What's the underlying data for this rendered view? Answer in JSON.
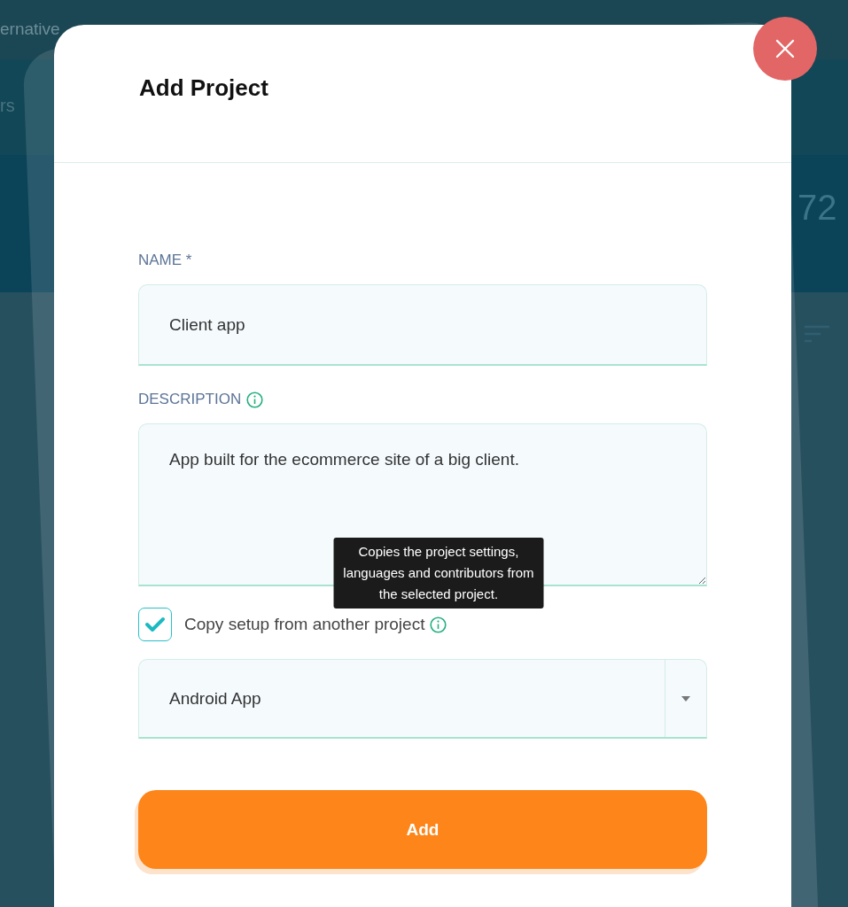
{
  "background": {
    "texts": [
      {
        "kind": "nav",
        "text": "ernative"
      },
      {
        "kind": "tab",
        "text": "rs"
      },
      {
        "kind": "stat",
        "text": "72"
      }
    ]
  },
  "dialog": {
    "title": "Add Project",
    "fields": [
      {
        "kind": "input",
        "label": "NAME *",
        "info": false,
        "value": "Client app"
      },
      {
        "kind": "textarea",
        "label": "DESCRIPTION",
        "info": true,
        "value": "App built for the ecommerce site of a big client."
      }
    ],
    "copy_setup": {
      "label": "Copy setup from another project",
      "checked": true,
      "info": true,
      "tooltip": "Copies the project settings, languages and contributors from the selected project."
    },
    "project_select": {
      "value": "Android App"
    },
    "submit": "Add"
  }
}
